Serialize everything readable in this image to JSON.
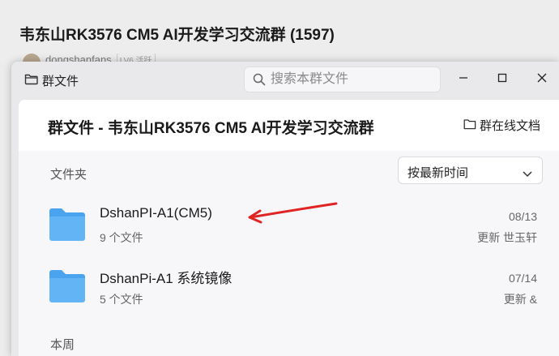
{
  "chat": {
    "title": "韦东山RK3576 CM5 AI开发学习交流群 (1597)",
    "sender_name": "dongshanfans",
    "sender_badge": "LV6 活跃"
  },
  "dialog": {
    "window_title": "群文件",
    "search_placeholder": "搜索本群文件",
    "header_title": "群文件 - 韦东山RK3576 CM5 AI开发学习交流群",
    "online_docs_label": "群在线文档",
    "folder_section_label": "文件夹",
    "sort_label": "按最新时间",
    "week_section_label": "本周",
    "folders": [
      {
        "name": "DshanPI-A1(CM5)",
        "count": "9 个文件",
        "date": "08/13",
        "update": "更新 世玉轩"
      },
      {
        "name": "DshanPi-A1 系统镜像",
        "count": "5 个文件",
        "date": "07/14",
        "update": "更新 &"
      }
    ]
  },
  "colors": {
    "folder": "#63b4f4",
    "folder_dark": "#4aa3ee",
    "annotation_arrow": "#e02323"
  },
  "icons": [
    "folder-icon",
    "search-icon",
    "minimize-icon",
    "maximize-icon",
    "close-icon",
    "online-doc-icon",
    "chevron-down-icon",
    "arrow-annotation"
  ]
}
